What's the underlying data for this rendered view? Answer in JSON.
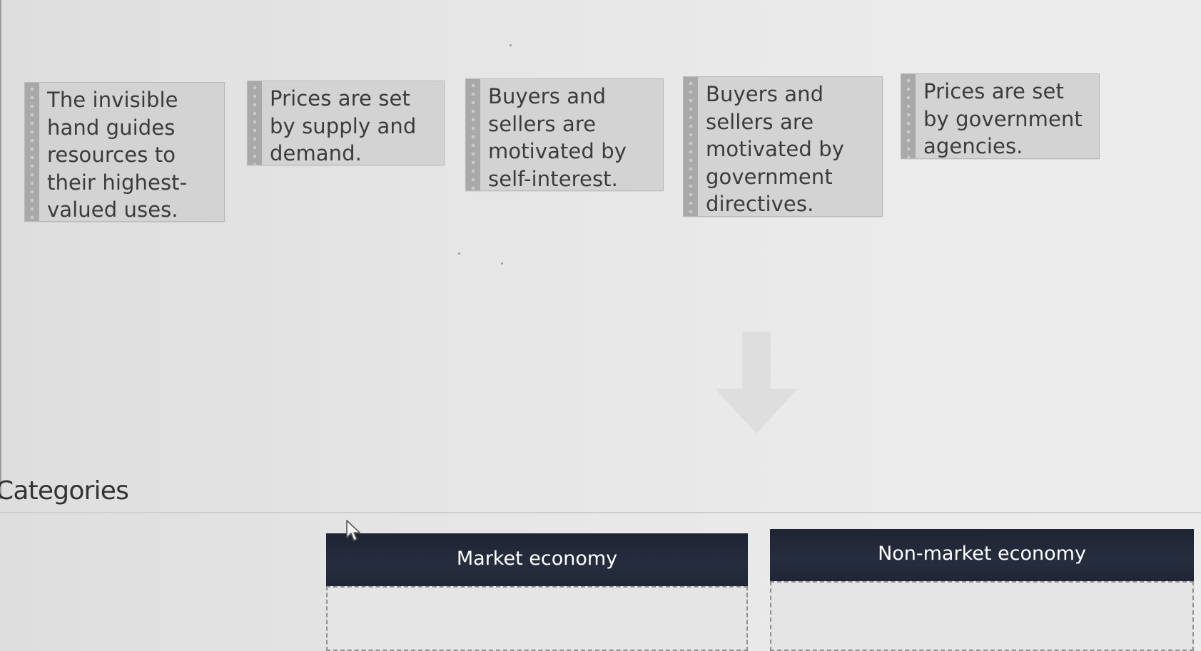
{
  "cards": [
    {
      "text": "The invisible hand guides resources to their highest-valued uses."
    },
    {
      "text": "Prices are set by supply and demand."
    },
    {
      "text": "Buyers and sellers are motivated by self-interest."
    },
    {
      "text": "Buyers and sellers are motivated by government directives."
    },
    {
      "text": "Prices are set by government agencies."
    }
  ],
  "categories_section": {
    "title": "Categories",
    "items": [
      {
        "label": "Market economy"
      },
      {
        "label": "Non-market economy"
      }
    ]
  },
  "icons": {
    "drop_hint": "down-arrow-icon",
    "cursor": "mouse-pointer-icon",
    "card_handle": "drag-handle-icon"
  },
  "colors": {
    "card_background": "#d3d3d3",
    "handle": "#a9a9a9",
    "category_header": "#232a3a",
    "category_header_text": "#ffffff",
    "page_background": "#e6e6e6"
  }
}
